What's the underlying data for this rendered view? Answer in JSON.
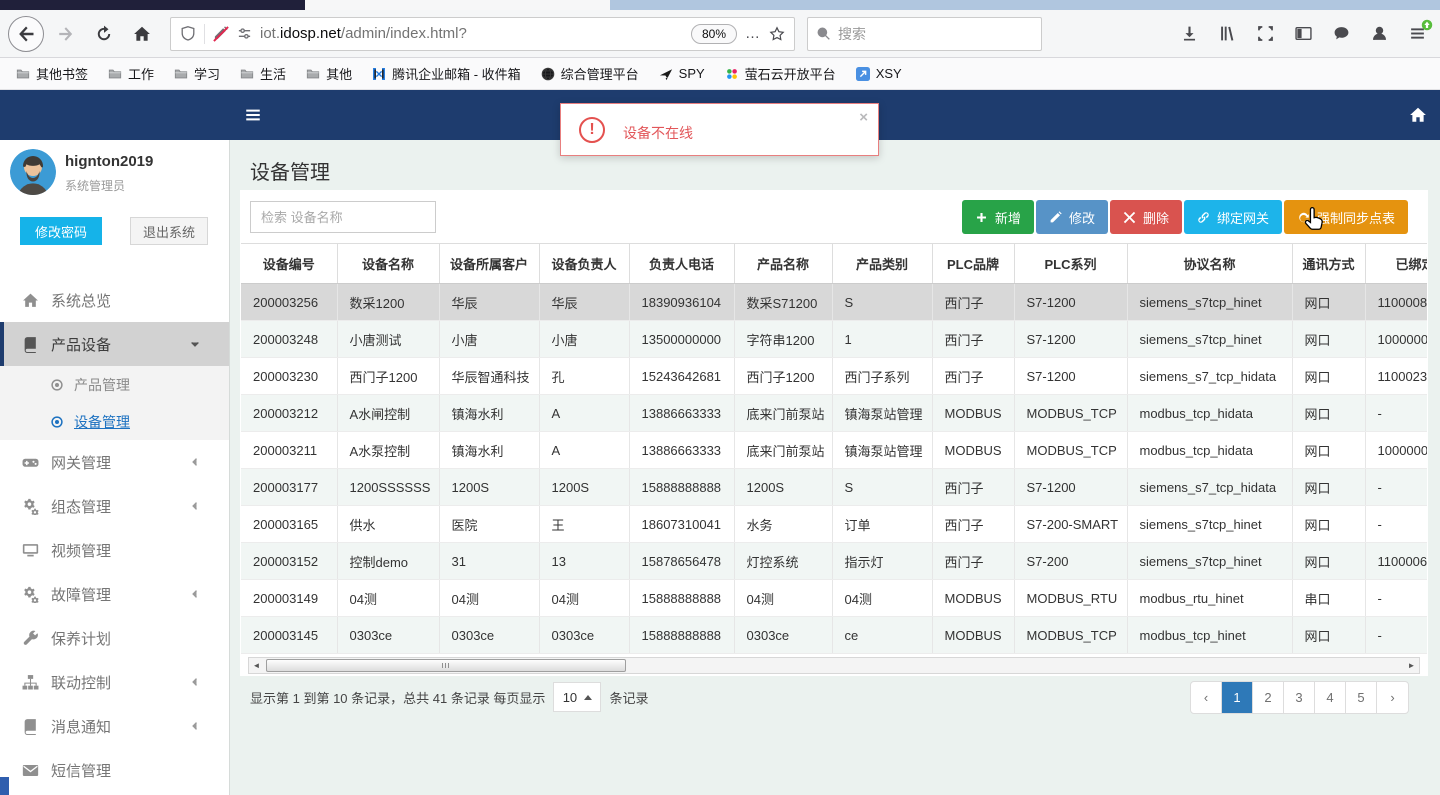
{
  "browser": {
    "nav_icons": [
      "back",
      "forward",
      "reload",
      "home"
    ],
    "url": {
      "prefix": "iot.",
      "domain": "idosp.net",
      "path": "/admin/index.html?"
    },
    "zoom_level": "80%",
    "page_actions": "…",
    "search_placeholder": "搜索",
    "right_icons": [
      "download",
      "library",
      "screenshot",
      "sidebar",
      "pocket",
      "account",
      "menu"
    ],
    "bookmarks": [
      {
        "label": "其他书签",
        "icon": "folder"
      },
      {
        "label": "工作",
        "icon": "folder"
      },
      {
        "label": "学习",
        "icon": "folder"
      },
      {
        "label": "生活",
        "icon": "folder"
      },
      {
        "label": "其他",
        "icon": "folder"
      },
      {
        "label": "腾讯企业邮箱 - 收件箱",
        "icon": "tencent-mail"
      },
      {
        "label": "综合管理平台",
        "icon": "globe"
      },
      {
        "label": "SPY",
        "icon": "plane"
      },
      {
        "label": "萤石云开放平台",
        "icon": "ezviz"
      },
      {
        "label": "XSY",
        "icon": "xsy"
      }
    ]
  },
  "sidebar": {
    "user": {
      "name": "hignton2019",
      "role": "系统管理员"
    },
    "change_password": "修改密码",
    "logout": "退出系统",
    "menu": [
      {
        "label": "系统总览",
        "icon": "home"
      },
      {
        "label": "产品设备",
        "icon": "book",
        "state": "active",
        "chevron": "down"
      },
      {
        "label": "产品管理",
        "icon": "dot-circle",
        "sub": true
      },
      {
        "label": "设备管理",
        "icon": "dot-circle",
        "sub": true,
        "state": "selected"
      },
      {
        "label": "网关管理",
        "icon": "gamepad",
        "chevron": "left"
      },
      {
        "label": "组态管理",
        "icon": "gears",
        "chevron": "left"
      },
      {
        "label": "视频管理",
        "icon": "monitor"
      },
      {
        "label": "故障管理",
        "icon": "gears",
        "chevron": "left"
      },
      {
        "label": "保养计划",
        "icon": "wrench"
      },
      {
        "label": "联动控制",
        "icon": "sitemap",
        "chevron": "left"
      },
      {
        "label": "消息通知",
        "icon": "book",
        "chevron": "left"
      },
      {
        "label": "短信管理",
        "icon": "envelope"
      }
    ]
  },
  "alert": {
    "message": "设备不在线",
    "close": "×"
  },
  "page": {
    "title": "设备管理",
    "search_placeholder": "检索 设备名称"
  },
  "actions": [
    {
      "id": "add",
      "label": "新增",
      "icon": "plus",
      "color": "#28a348"
    },
    {
      "id": "edit",
      "label": "修改",
      "icon": "pencil",
      "color": "#5793c7"
    },
    {
      "id": "delete",
      "label": "删除",
      "icon": "x",
      "color": "#d9534f"
    },
    {
      "id": "bind-gateway",
      "label": "绑定网关",
      "icon": "link",
      "color": "#1db4ea"
    },
    {
      "id": "force-sync-points",
      "label": "强制同步点表",
      "icon": "refresh",
      "color": "#e5930f"
    }
  ],
  "table": {
    "headers": [
      "设备编号",
      "设备名称",
      "设备所属客户",
      "设备负责人",
      "负责人电话",
      "产品名称",
      "产品类别",
      "PLC品牌",
      "PLC系列",
      "协议名称",
      "通讯方式",
      "已绑定网关"
    ],
    "rows": [
      {
        "selected": true,
        "cells": [
          "200003256",
          "数采1200",
          "华辰",
          "华辰",
          "18390936104",
          "数采S71200",
          "S",
          "西门子",
          "S7-1200",
          "siemens_s7tcp_hinet",
          "网口",
          "1100008"
        ]
      },
      {
        "selected": false,
        "cells": [
          "200003248",
          "小唐测试",
          "小唐",
          "小唐",
          "13500000000",
          "字符串1200",
          "1",
          "西门子",
          "S7-1200",
          "siemens_s7tcp_hinet",
          "网口",
          "1000000"
        ]
      },
      {
        "selected": false,
        "cells": [
          "200003230",
          "西门子1200",
          "华辰智通科技",
          "孔",
          "15243642681",
          "西门子1200",
          "西门子系列",
          "西门子",
          "S7-1200",
          "siemens_s7_tcp_hidata",
          "网口",
          "1100023"
        ]
      },
      {
        "selected": false,
        "cells": [
          "200003212",
          "A水闸控制",
          "镇海水利",
          "A",
          "13886663333",
          "底来门前泵站",
          "镇海泵站管理",
          "MODBUS",
          "MODBUS_TCP",
          "modbus_tcp_hidata",
          "网口",
          "-"
        ]
      },
      {
        "selected": false,
        "cells": [
          "200003211",
          "A水泵控制",
          "镇海水利",
          "A",
          "13886663333",
          "底来门前泵站",
          "镇海泵站管理",
          "MODBUS",
          "MODBUS_TCP",
          "modbus_tcp_hidata",
          "网口",
          "1000000"
        ]
      },
      {
        "selected": false,
        "cells": [
          "200003177",
          "1200SSSSSS",
          "1200S",
          "1200S",
          "15888888888",
          "1200S",
          "S",
          "西门子",
          "S7-1200",
          "siemens_s7_tcp_hidata",
          "网口",
          "-"
        ]
      },
      {
        "selected": false,
        "cells": [
          "200003165",
          "供水",
          "医院",
          "王",
          "18607310041",
          "水务",
          "订单",
          "西门子",
          "S7-200-SMART",
          "siemens_s7tcp_hinet",
          "网口",
          "-"
        ]
      },
      {
        "selected": false,
        "cells": [
          "200003152",
          "控制demo",
          "31",
          "13",
          "15878656478",
          "灯控系统",
          "指示灯",
          "西门子",
          "S7-200",
          "siemens_s7tcp_hinet",
          "网口",
          "1100006"
        ]
      },
      {
        "selected": false,
        "cells": [
          "200003149",
          "04测",
          "04测",
          "04测",
          "15888888888",
          "04测",
          "04测",
          "MODBUS",
          "MODBUS_RTU",
          "modbus_rtu_hinet",
          "串口",
          "-"
        ]
      },
      {
        "selected": false,
        "cells": [
          "200003145",
          "0303ce",
          "0303ce",
          "0303ce",
          "15888888888",
          "0303ce",
          "ce",
          "MODBUS",
          "MODBUS_TCP",
          "modbus_tcp_hinet",
          "网口",
          "-"
        ]
      }
    ]
  },
  "footer": {
    "summary_before": "显示第 1 到第 10 条记录，总共 41 条记录 每页显示",
    "page_size": "10",
    "summary_after": "条记录",
    "pagination": {
      "prev": "‹",
      "pages": [
        "1",
        "2",
        "3",
        "4",
        "5"
      ],
      "next": "›",
      "active": "1"
    }
  },
  "colors": {
    "topbar_navy": "#1e3c6e",
    "alert_red": "#e2575a",
    "link_blue": "#1c71c0",
    "pagination_active": "#2e79b8",
    "selected_row": "#d8d8d8",
    "password_button": "#15b3e9"
  }
}
